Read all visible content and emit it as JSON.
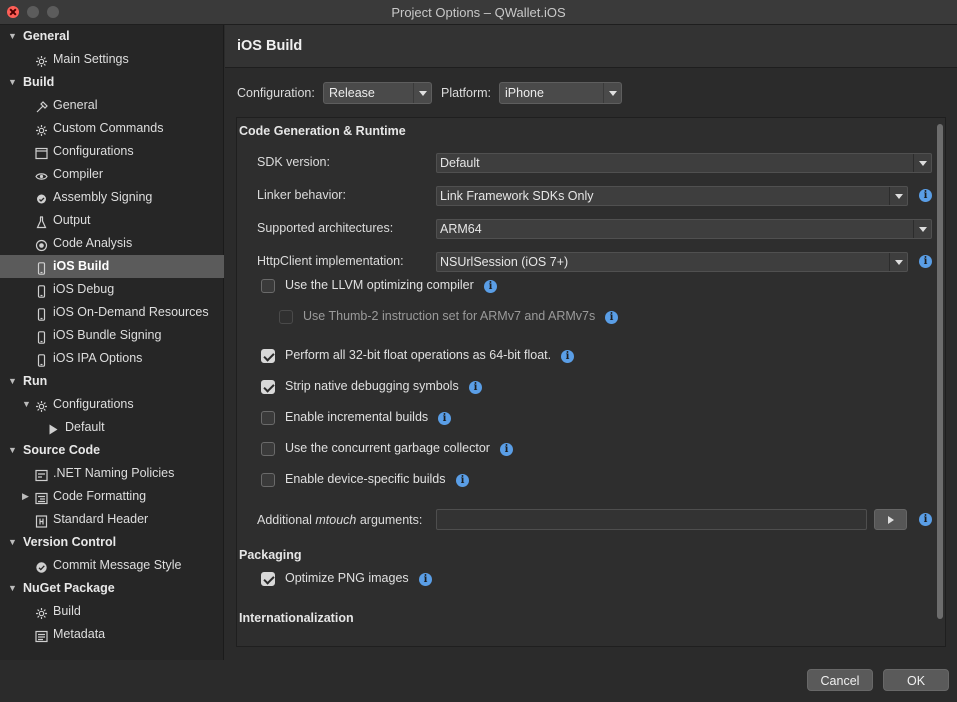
{
  "window": {
    "title": "Project Options – QWallet.iOS"
  },
  "sidebar": {
    "items": [
      {
        "label": "General",
        "type": "section",
        "icon": "triangle-down"
      },
      {
        "label": "Main Settings",
        "type": "item",
        "icon": "gear-icon"
      },
      {
        "label": "Build",
        "type": "section",
        "icon": "triangle-down"
      },
      {
        "label": "General",
        "type": "item",
        "icon": "hammer-icon"
      },
      {
        "label": "Custom Commands",
        "type": "item",
        "icon": "gear-icon"
      },
      {
        "label": "Configurations",
        "type": "item",
        "icon": "window-icon"
      },
      {
        "label": "Compiler",
        "type": "item",
        "icon": "eye-icon"
      },
      {
        "label": "Assembly Signing",
        "type": "item",
        "icon": "badge-icon"
      },
      {
        "label": "Output",
        "type": "item",
        "icon": "flask-icon"
      },
      {
        "label": "Code Analysis",
        "type": "item",
        "icon": "target-icon"
      },
      {
        "label": "iOS Build",
        "type": "item",
        "icon": "phone-icon",
        "selected": true
      },
      {
        "label": "iOS Debug",
        "type": "item",
        "icon": "phone-icon"
      },
      {
        "label": "iOS On-Demand Resources",
        "type": "item",
        "icon": "phone-icon"
      },
      {
        "label": "iOS Bundle Signing",
        "type": "item",
        "icon": "phone-icon"
      },
      {
        "label": "iOS IPA Options",
        "type": "item",
        "icon": "phone-icon"
      },
      {
        "label": "Run",
        "type": "section",
        "icon": "triangle-down"
      },
      {
        "label": "Configurations",
        "type": "subsection",
        "icon": "gear-icon"
      },
      {
        "label": "Default",
        "type": "subitem",
        "icon": "play-icon"
      },
      {
        "label": "Source Code",
        "type": "section",
        "icon": "triangle-down"
      },
      {
        "label": ".NET Naming Policies",
        "type": "item",
        "icon": "grid-icon"
      },
      {
        "label": "Code Formatting",
        "type": "item-collapsed",
        "icon": "format-icon"
      },
      {
        "label": "Standard Header",
        "type": "item",
        "icon": "header-icon"
      },
      {
        "label": "Version Control",
        "type": "section",
        "icon": "triangle-down"
      },
      {
        "label": "Commit Message Style",
        "type": "item",
        "icon": "commit-icon"
      },
      {
        "label": "NuGet Package",
        "type": "section",
        "icon": "triangle-down"
      },
      {
        "label": "Build",
        "type": "item",
        "icon": "gear-icon"
      },
      {
        "label": "Metadata",
        "type": "item",
        "icon": "list-icon"
      }
    ]
  },
  "main": {
    "title": "iOS Build",
    "configuration": {
      "label": "Configuration:",
      "value": "Release"
    },
    "platform": {
      "label": "Platform:",
      "value": "iPhone"
    },
    "sections": {
      "codegen": "Code Generation & Runtime",
      "packaging": "Packaging",
      "i18n": "Internationalization"
    },
    "fields": {
      "sdk_version": {
        "label": "SDK version:",
        "value": "Default"
      },
      "linker": {
        "label": "Linker behavior:",
        "value": "Link Framework SDKs Only"
      },
      "architectures": {
        "label": "Supported architectures:",
        "value": "ARM64"
      },
      "httpclient": {
        "label": "HttpClient implementation:",
        "value": "NSUrlSession (iOS 7+)"
      },
      "mtouch_pre": "Additional ",
      "mtouch_em": "mtouch",
      "mtouch_post": " arguments:",
      "mtouch_value": ""
    },
    "checks": [
      {
        "label": "Use the LLVM optimizing compiler",
        "checked": false,
        "info": true
      },
      {
        "label": "Use Thumb-2 instruction set for ARMv7 and ARMv7s",
        "checked": false,
        "disabled": true,
        "info": true
      },
      {
        "label": "Perform all 32-bit float operations as 64-bit float.",
        "checked": true,
        "info": true
      },
      {
        "label": "Strip native debugging symbols",
        "checked": true,
        "info": true
      },
      {
        "label": "Enable incremental builds",
        "checked": false,
        "info": true
      },
      {
        "label": "Use the concurrent garbage collector",
        "checked": false,
        "info": true
      },
      {
        "label": "Enable device-specific builds",
        "checked": false,
        "info": true
      }
    ],
    "packaging_checks": [
      {
        "label": "Optimize PNG images",
        "checked": true,
        "info": true
      }
    ]
  },
  "footer": {
    "cancel": "Cancel",
    "ok": "OK"
  },
  "colors": {
    "accent_info": "#5a9ee6",
    "selection": "#5b5b5b",
    "close": "#ff5f57"
  }
}
